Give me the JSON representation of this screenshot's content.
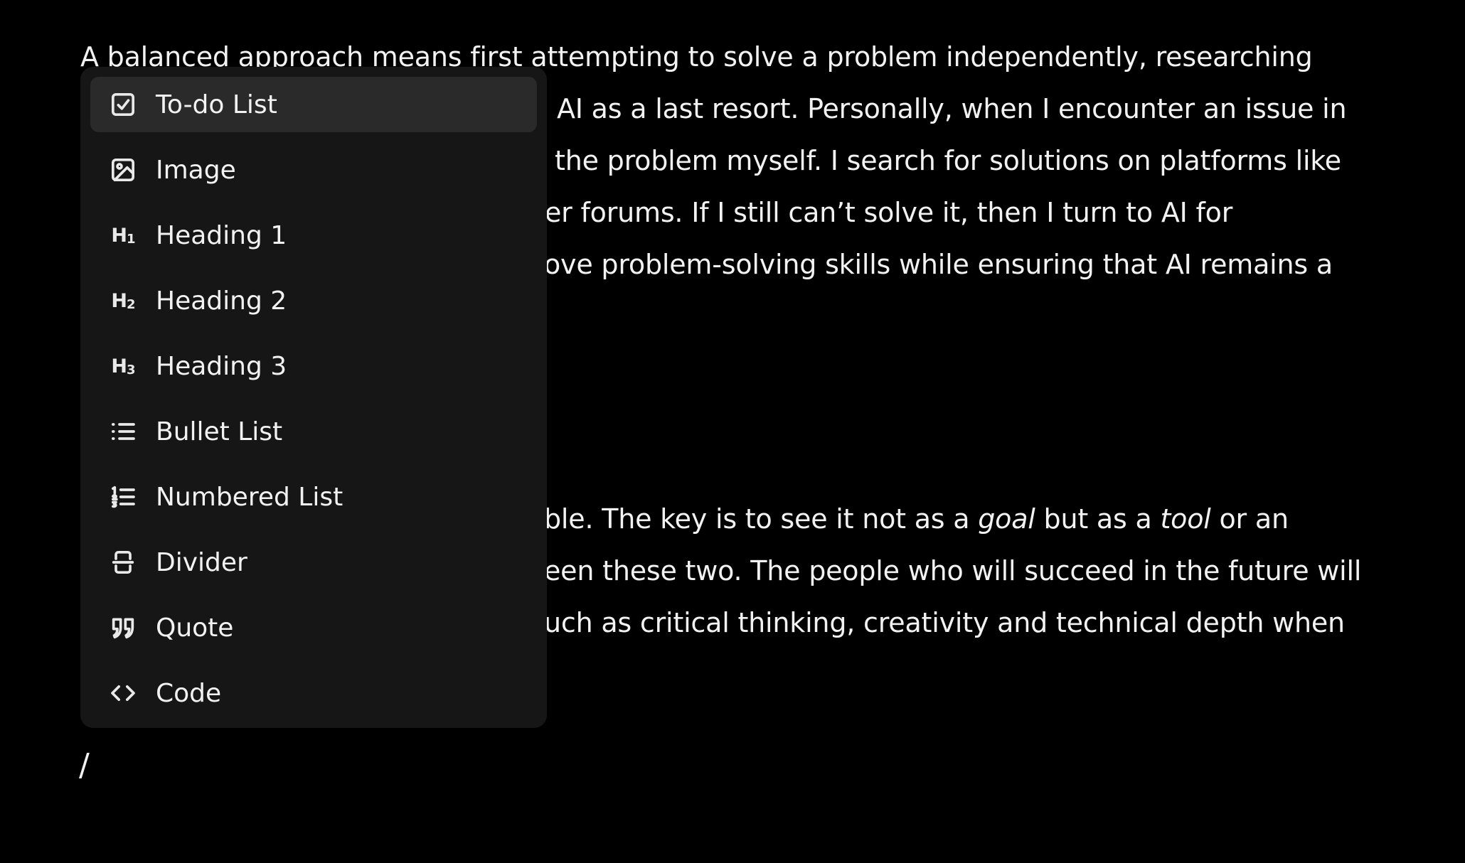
{
  "editor": {
    "para_a": [
      "A balanced approach means first attempting to solve a problem independently, researching",
      "AI as a last resort. Personally, when I encounter an issue in",
      "the problem myself. I search for solutions on platforms like",
      "er forums. If I still can’t solve it, then I turn to AI for",
      "ove problem-solving skills while ensuring that AI remains a"
    ],
    "para_b": {
      "line1_pre": "ble. The key is to see it not as a ",
      "line1_em1": "goal",
      "line1_mid": " but as a ",
      "line1_em2": "tool",
      "line1_post": " or an",
      "line2": "een these two. The people who will succeed in the future will",
      "line3": "uch as critical thinking, creativity and technical depth when"
    },
    "slash": "/"
  },
  "menu": {
    "items": [
      {
        "label": "To-do List",
        "icon": "checkbox-icon",
        "active": true
      },
      {
        "label": "Image",
        "icon": "image-icon"
      },
      {
        "label": "Heading 1",
        "icon": "heading-1-icon",
        "icon_text": "H",
        "icon_sub": "1"
      },
      {
        "label": "Heading 2",
        "icon": "heading-2-icon",
        "icon_text": "H",
        "icon_sub": "2"
      },
      {
        "label": "Heading 3",
        "icon": "heading-3-icon",
        "icon_text": "H",
        "icon_sub": "3"
      },
      {
        "label": "Bullet List",
        "icon": "bullet-list-icon"
      },
      {
        "label": "Numbered List",
        "icon": "numbered-list-icon"
      },
      {
        "label": "Divider",
        "icon": "divider-icon"
      },
      {
        "label": "Quote",
        "icon": "quote-icon"
      },
      {
        "label": "Code",
        "icon": "code-icon"
      }
    ]
  }
}
